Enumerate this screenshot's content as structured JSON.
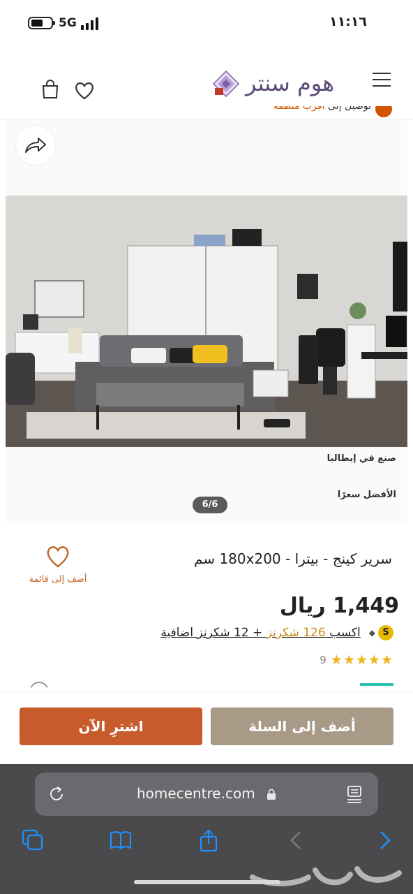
{
  "status_bar": {
    "time": "١١:١٦",
    "network": "5G",
    "battery_level": 0.5
  },
  "header": {
    "logo_text": "هوم سنتر",
    "icons": [
      "hamburger-menu-icon",
      "shopping-bag-icon",
      "heart-icon"
    ]
  },
  "promo": {
    "text": "توصيل إلى",
    "highlight": "أقرب منطقة"
  },
  "gallery": {
    "current_slide": "6/6",
    "badge_made_in": "صنع في إيطاليا",
    "badge_best_price": "الأفضل سعرًا"
  },
  "product": {
    "title": "سرير كينج - بيترا - 180x200 سم",
    "wishlist_label": "أضف إلى قائمة",
    "price": "1,449 ريال",
    "shukran_coin": "S",
    "points_earn": "اكسب",
    "points_value": "126 شكرنز",
    "points_extra": "+ 12 شكرنز اضافية",
    "rating_stars": 5,
    "rating_count": "9"
  },
  "actions": {
    "buy_now": "اشترِ الآن",
    "add_to_cart": "أضف إلى السلة"
  },
  "browser": {
    "url": "homecentre.com"
  },
  "colors": {
    "brand_orange": "#c85b2c",
    "cart_beige": "#a89a87",
    "logo_purple": "#5b4a7a",
    "star_gold": "#f2b21b",
    "browser_gray": "#4a4a4c"
  }
}
